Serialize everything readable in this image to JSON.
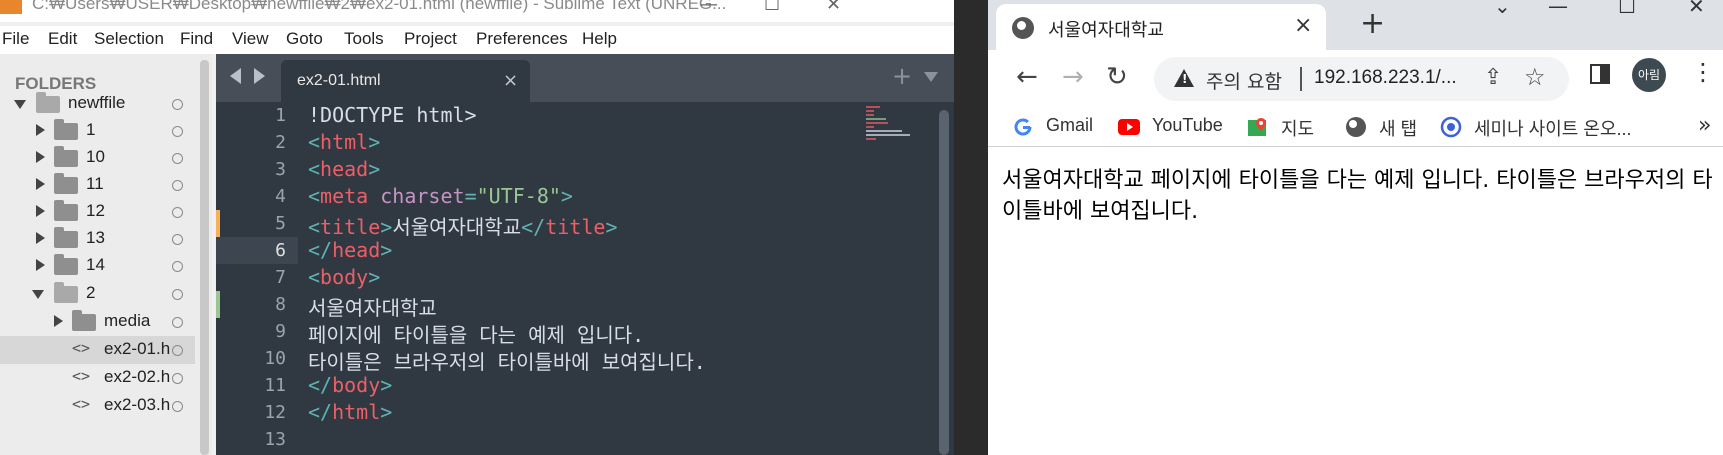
{
  "sublime": {
    "window_title": "C:₩Users₩USER₩Desktop₩newffile₩2₩ex2-01.html (newffile) - Sublime Text (UNREG...",
    "menu": [
      "File",
      "Edit",
      "Selection",
      "Find",
      "View",
      "Goto",
      "Tools",
      "Project",
      "Preferences",
      "Help"
    ],
    "sidebar": {
      "header": "FOLDERS",
      "tree": [
        {
          "label": "newffile",
          "kind": "folder-open",
          "expanded": true
        },
        {
          "label": "1",
          "kind": "folder"
        },
        {
          "label": "10",
          "kind": "folder"
        },
        {
          "label": "11",
          "kind": "folder"
        },
        {
          "label": "12",
          "kind": "folder"
        },
        {
          "label": "13",
          "kind": "folder"
        },
        {
          "label": "14",
          "kind": "folder"
        },
        {
          "label": "2",
          "kind": "folder-open",
          "expanded": true
        },
        {
          "label": "media",
          "kind": "folder"
        },
        {
          "label": "ex2-01.h",
          "kind": "file",
          "selected": true
        },
        {
          "label": "ex2-02.h",
          "kind": "file"
        },
        {
          "label": "ex2-03.h",
          "kind": "file"
        }
      ]
    },
    "tab": {
      "label": "ex2-01.html",
      "close": "×"
    },
    "editor": {
      "active_line": 6,
      "line_numbers": [
        "1",
        "2",
        "3",
        "4",
        "5",
        "6",
        "7",
        "8",
        "9",
        "10",
        "11",
        "12",
        "13"
      ],
      "lines": [
        "<!DOCTYPE html>",
        "<html>",
        "<head>",
        "<meta charset=\"UTF-8\">",
        "<title>서울여자대학교</title>",
        "</head>",
        "<body>",
        "서울여자대학교",
        "페이지에 타이틀을 다는 예제 입니다.",
        "타이틀은 브라우저의 타이틀바에 보여집니다.",
        "</body>",
        "</html>",
        ""
      ]
    }
  },
  "chrome": {
    "tab_title": "서울여자대학교",
    "tab_close": "×",
    "new_tab": "+",
    "omnibox": {
      "warning": "주의 요함",
      "url": "192.168.223.1/..."
    },
    "avatar": "아림",
    "bookmarks": [
      {
        "label": "Gmail",
        "icon": "google-icon"
      },
      {
        "label": "YouTube",
        "icon": "youtube-icon"
      },
      {
        "label": "지도",
        "icon": "maps-icon"
      },
      {
        "label": "새 탭",
        "icon": "globe-icon"
      },
      {
        "label": "세미나 사이트 온오...",
        "icon": "site-icon"
      }
    ],
    "bookmarks_more": "»",
    "page_text": "서울여자대학교 페이지에 타이틀을 다는 예제 입니다. 타이틀은 브라우저의 타이틀바에 보여집니다."
  },
  "colors": {
    "editor_bg": "#303841",
    "tag": "#ec5f67",
    "punct": "#5fb3b3",
    "keyword": "#c594c5",
    "string": "#99c794",
    "modified_marker": "#f9ae58",
    "added_marker": "#99c794"
  }
}
